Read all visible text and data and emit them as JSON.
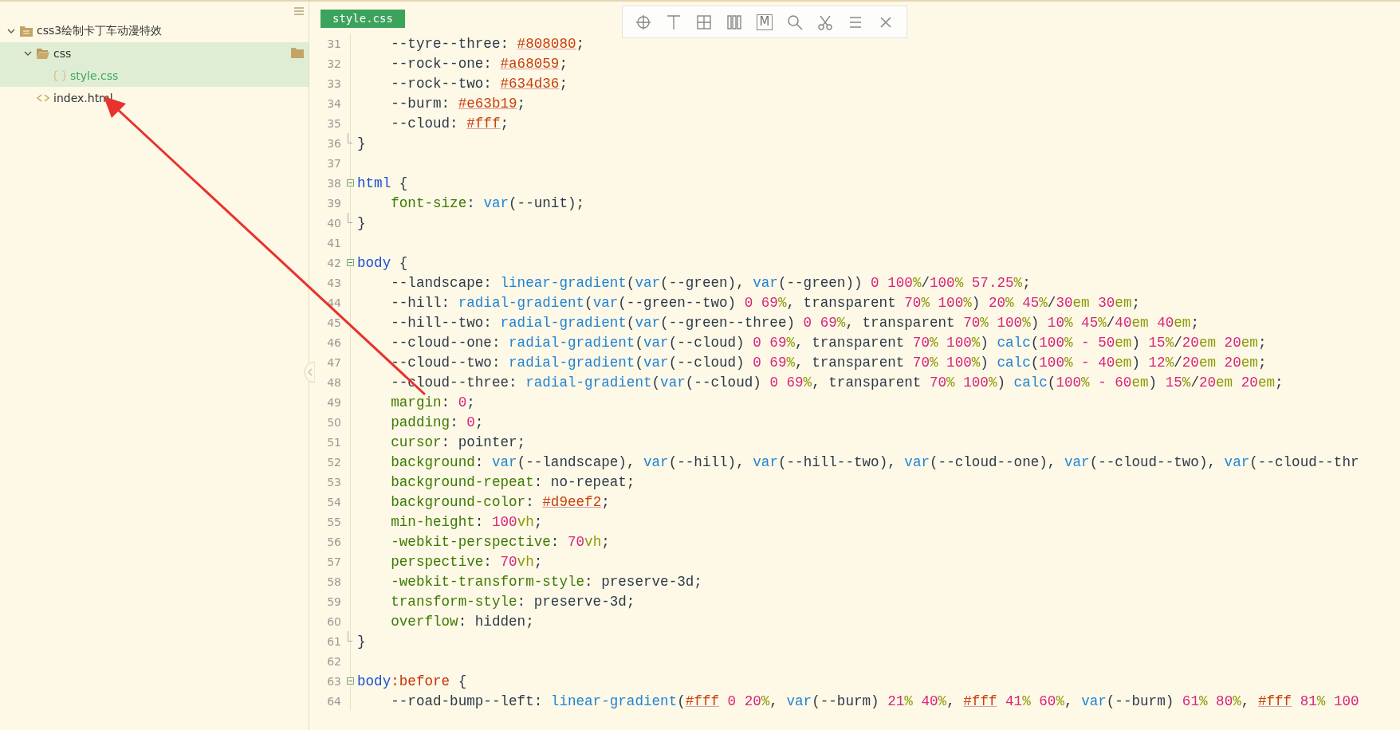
{
  "sidebar": {
    "tree": [
      {
        "label": "css3绘制卡丁车动漫特效",
        "kind": "project",
        "expanded": true,
        "selected": false,
        "hovered": false,
        "children": [
          {
            "label": "css",
            "kind": "folder",
            "expanded": true,
            "selected": true,
            "hovered": true,
            "children": [
              {
                "label": "style.css",
                "kind": "css",
                "selected": true,
                "open": true
              }
            ]
          },
          {
            "label": "index.html",
            "kind": "html",
            "selected": false,
            "hovered": false
          }
        ]
      }
    ]
  },
  "editor": {
    "tab": {
      "label": "style.css",
      "selected": true
    },
    "toolbar": [
      {
        "kind": "crosshair"
      },
      {
        "kind": "text-line"
      },
      {
        "kind": "grid"
      },
      {
        "kind": "columns"
      },
      {
        "kind": "letter-box",
        "label": "M"
      },
      {
        "kind": "search"
      },
      {
        "kind": "scissors"
      },
      {
        "kind": "menu"
      },
      {
        "kind": "close"
      }
    ],
    "lines": [
      {
        "number": "31",
        "indent": true,
        "code": [
          {
            "kind": "plain",
            "text": "--tyre--three: "
          },
          {
            "kind": "hex",
            "text": "#808080"
          },
          {
            "kind": "plain",
            "text": ";"
          }
        ]
      },
      {
        "number": "32",
        "indent": true,
        "code": [
          {
            "kind": "plain",
            "text": "--rock--one: "
          },
          {
            "kind": "hex",
            "text": "#a68059"
          },
          {
            "kind": "plain",
            "text": ";"
          }
        ]
      },
      {
        "number": "33",
        "indent": true,
        "code": [
          {
            "kind": "plain",
            "text": "--rock--two: "
          },
          {
            "kind": "hex",
            "text": "#634d36"
          },
          {
            "kind": "plain",
            "text": ";"
          }
        ]
      },
      {
        "number": "34",
        "indent": true,
        "code": [
          {
            "kind": "plain",
            "text": "--burm: "
          },
          {
            "kind": "hex",
            "text": "#e63b19"
          },
          {
            "kind": "plain",
            "text": ";"
          }
        ]
      },
      {
        "number": "35",
        "indent": true,
        "code": [
          {
            "kind": "plain",
            "text": "--cloud: "
          },
          {
            "kind": "hex",
            "text": "#fff"
          },
          {
            "kind": "plain",
            "text": ";"
          }
        ]
      },
      {
        "number": "36",
        "fold": {
          "kind": "end"
        },
        "code": [
          {
            "kind": "plain",
            "text": "}"
          }
        ]
      },
      {
        "number": "37"
      },
      {
        "number": "38",
        "fold": {
          "kind": "start"
        },
        "code": [
          {
            "kind": "sel",
            "text": "html"
          },
          {
            "kind": "plain",
            "text": " {"
          }
        ]
      },
      {
        "number": "39",
        "indent": true,
        "code": [
          {
            "kind": "prop",
            "text": "font-size"
          },
          {
            "kind": "plain",
            "text": ": "
          },
          {
            "kind": "fn",
            "text": "var"
          },
          {
            "kind": "plain",
            "text": "(--unit);"
          }
        ]
      },
      {
        "number": "40",
        "fold": {
          "kind": "end"
        },
        "code": [
          {
            "kind": "plain",
            "text": "}"
          }
        ]
      },
      {
        "number": "41"
      },
      {
        "number": "42",
        "fold": {
          "kind": "start"
        },
        "code": [
          {
            "kind": "sel",
            "text": "body"
          },
          {
            "kind": "plain",
            "text": " {"
          }
        ]
      },
      {
        "number": "43",
        "indent": true,
        "code": [
          {
            "kind": "plain",
            "text": "--landscape: "
          },
          {
            "kind": "fn",
            "text": "linear-gradient"
          },
          {
            "kind": "plain",
            "text": "("
          },
          {
            "kind": "fn",
            "text": "var"
          },
          {
            "kind": "plain",
            "text": "(--green), "
          },
          {
            "kind": "fn",
            "text": "var"
          },
          {
            "kind": "plain",
            "text": "(--green)) "
          },
          {
            "kind": "num",
            "text": "0 100"
          },
          {
            "kind": "unit",
            "text": "%"
          },
          {
            "kind": "plain",
            "text": "/"
          },
          {
            "kind": "num",
            "text": "100"
          },
          {
            "kind": "unit",
            "text": "%"
          },
          {
            "kind": "num",
            "text": " 57.25"
          },
          {
            "kind": "unit",
            "text": "%"
          },
          {
            "kind": "plain",
            "text": ";"
          }
        ]
      },
      {
        "number": "44",
        "indent": true,
        "code": [
          {
            "kind": "plain",
            "text": "--hill: "
          },
          {
            "kind": "fn",
            "text": "radial-gradient"
          },
          {
            "kind": "plain",
            "text": "("
          },
          {
            "kind": "fn",
            "text": "var"
          },
          {
            "kind": "plain",
            "text": "(--green--two) "
          },
          {
            "kind": "num",
            "text": "0 69"
          },
          {
            "kind": "unit",
            "text": "%"
          },
          {
            "kind": "plain",
            "text": ", transparent "
          },
          {
            "kind": "num",
            "text": "70"
          },
          {
            "kind": "unit",
            "text": "%"
          },
          {
            "kind": "num",
            "text": " 100"
          },
          {
            "kind": "unit",
            "text": "%"
          },
          {
            "kind": "plain",
            "text": ") "
          },
          {
            "kind": "num",
            "text": "20"
          },
          {
            "kind": "unit",
            "text": "%"
          },
          {
            "kind": "num",
            "text": " 45"
          },
          {
            "kind": "unit",
            "text": "%"
          },
          {
            "kind": "plain",
            "text": "/"
          },
          {
            "kind": "num",
            "text": "30"
          },
          {
            "kind": "unit",
            "text": "em"
          },
          {
            "kind": "num",
            "text": " 30"
          },
          {
            "kind": "unit",
            "text": "em"
          },
          {
            "kind": "plain",
            "text": ";"
          }
        ]
      },
      {
        "number": "45",
        "indent": true,
        "code": [
          {
            "kind": "plain",
            "text": "--hill--two: "
          },
          {
            "kind": "fn",
            "text": "radial-gradient"
          },
          {
            "kind": "plain",
            "text": "("
          },
          {
            "kind": "fn",
            "text": "var"
          },
          {
            "kind": "plain",
            "text": "(--green--three) "
          },
          {
            "kind": "num",
            "text": "0 69"
          },
          {
            "kind": "unit",
            "text": "%"
          },
          {
            "kind": "plain",
            "text": ", transparent "
          },
          {
            "kind": "num",
            "text": "70"
          },
          {
            "kind": "unit",
            "text": "%"
          },
          {
            "kind": "num",
            "text": " 100"
          },
          {
            "kind": "unit",
            "text": "%"
          },
          {
            "kind": "plain",
            "text": ") "
          },
          {
            "kind": "num",
            "text": "10"
          },
          {
            "kind": "unit",
            "text": "%"
          },
          {
            "kind": "num",
            "text": " 45"
          },
          {
            "kind": "unit",
            "text": "%"
          },
          {
            "kind": "plain",
            "text": "/"
          },
          {
            "kind": "num",
            "text": "40"
          },
          {
            "kind": "unit",
            "text": "em"
          },
          {
            "kind": "num",
            "text": " 40"
          },
          {
            "kind": "unit",
            "text": "em"
          },
          {
            "kind": "plain",
            "text": ";"
          }
        ]
      },
      {
        "number": "46",
        "indent": true,
        "code": [
          {
            "kind": "plain",
            "text": "--cloud--one: "
          },
          {
            "kind": "fn",
            "text": "radial-gradient"
          },
          {
            "kind": "plain",
            "text": "("
          },
          {
            "kind": "fn",
            "text": "var"
          },
          {
            "kind": "plain",
            "text": "(--cloud) "
          },
          {
            "kind": "num",
            "text": "0 69"
          },
          {
            "kind": "unit",
            "text": "%"
          },
          {
            "kind": "plain",
            "text": ", transparent "
          },
          {
            "kind": "num",
            "text": "70"
          },
          {
            "kind": "unit",
            "text": "%"
          },
          {
            "kind": "num",
            "text": " 100"
          },
          {
            "kind": "unit",
            "text": "%"
          },
          {
            "kind": "plain",
            "text": ") "
          },
          {
            "kind": "fn",
            "text": "calc"
          },
          {
            "kind": "plain",
            "text": "("
          },
          {
            "kind": "num",
            "text": "100"
          },
          {
            "kind": "unit",
            "text": "%"
          },
          {
            "kind": "num",
            "text": " - 50"
          },
          {
            "kind": "unit",
            "text": "em"
          },
          {
            "kind": "plain",
            "text": ") "
          },
          {
            "kind": "num",
            "text": "15"
          },
          {
            "kind": "unit",
            "text": "%"
          },
          {
            "kind": "plain",
            "text": "/"
          },
          {
            "kind": "num",
            "text": "20"
          },
          {
            "kind": "unit",
            "text": "em"
          },
          {
            "kind": "num",
            "text": " 20"
          },
          {
            "kind": "unit",
            "text": "em"
          },
          {
            "kind": "plain",
            "text": ";"
          }
        ]
      },
      {
        "number": "47",
        "indent": true,
        "code": [
          {
            "kind": "plain",
            "text": "--cloud--two: "
          },
          {
            "kind": "fn",
            "text": "radial-gradient"
          },
          {
            "kind": "plain",
            "text": "("
          },
          {
            "kind": "fn",
            "text": "var"
          },
          {
            "kind": "plain",
            "text": "(--cloud) "
          },
          {
            "kind": "num",
            "text": "0 69"
          },
          {
            "kind": "unit",
            "text": "%"
          },
          {
            "kind": "plain",
            "text": ", transparent "
          },
          {
            "kind": "num",
            "text": "70"
          },
          {
            "kind": "unit",
            "text": "%"
          },
          {
            "kind": "num",
            "text": " 100"
          },
          {
            "kind": "unit",
            "text": "%"
          },
          {
            "kind": "plain",
            "text": ") "
          },
          {
            "kind": "fn",
            "text": "calc"
          },
          {
            "kind": "plain",
            "text": "("
          },
          {
            "kind": "num",
            "text": "100"
          },
          {
            "kind": "unit",
            "text": "%"
          },
          {
            "kind": "num",
            "text": " - 40"
          },
          {
            "kind": "unit",
            "text": "em"
          },
          {
            "kind": "plain",
            "text": ") "
          },
          {
            "kind": "num",
            "text": "12"
          },
          {
            "kind": "unit",
            "text": "%"
          },
          {
            "kind": "plain",
            "text": "/"
          },
          {
            "kind": "num",
            "text": "20"
          },
          {
            "kind": "unit",
            "text": "em"
          },
          {
            "kind": "num",
            "text": " 20"
          },
          {
            "kind": "unit",
            "text": "em"
          },
          {
            "kind": "plain",
            "text": ";"
          }
        ]
      },
      {
        "number": "48",
        "indent": true,
        "code": [
          {
            "kind": "plain",
            "text": "--cloud--three: "
          },
          {
            "kind": "fn",
            "text": "radial-gradient"
          },
          {
            "kind": "plain",
            "text": "("
          },
          {
            "kind": "fn",
            "text": "var"
          },
          {
            "kind": "plain",
            "text": "(--cloud) "
          },
          {
            "kind": "num",
            "text": "0 69"
          },
          {
            "kind": "unit",
            "text": "%"
          },
          {
            "kind": "plain",
            "text": ", transparent "
          },
          {
            "kind": "num",
            "text": "70"
          },
          {
            "kind": "unit",
            "text": "%"
          },
          {
            "kind": "num",
            "text": " 100"
          },
          {
            "kind": "unit",
            "text": "%"
          },
          {
            "kind": "plain",
            "text": ") "
          },
          {
            "kind": "fn",
            "text": "calc"
          },
          {
            "kind": "plain",
            "text": "("
          },
          {
            "kind": "num",
            "text": "100"
          },
          {
            "kind": "unit",
            "text": "%"
          },
          {
            "kind": "num",
            "text": " - 60"
          },
          {
            "kind": "unit",
            "text": "em"
          },
          {
            "kind": "plain",
            "text": ") "
          },
          {
            "kind": "num",
            "text": "15"
          },
          {
            "kind": "unit",
            "text": "%"
          },
          {
            "kind": "plain",
            "text": "/"
          },
          {
            "kind": "num",
            "text": "20"
          },
          {
            "kind": "unit",
            "text": "em"
          },
          {
            "kind": "num",
            "text": " 20"
          },
          {
            "kind": "unit",
            "text": "em"
          },
          {
            "kind": "plain",
            "text": ";"
          }
        ]
      },
      {
        "number": "49",
        "indent": true,
        "code": [
          {
            "kind": "prop",
            "text": "margin"
          },
          {
            "kind": "plain",
            "text": ": "
          },
          {
            "kind": "num",
            "text": "0"
          },
          {
            "kind": "plain",
            "text": ";"
          }
        ]
      },
      {
        "number": "50",
        "indent": true,
        "code": [
          {
            "kind": "prop",
            "text": "padding"
          },
          {
            "kind": "plain",
            "text": ": "
          },
          {
            "kind": "num",
            "text": "0"
          },
          {
            "kind": "plain",
            "text": ";"
          }
        ]
      },
      {
        "number": "51",
        "indent": true,
        "code": [
          {
            "kind": "prop",
            "text": "cursor"
          },
          {
            "kind": "plain",
            "text": ": pointer;"
          }
        ]
      },
      {
        "number": "52",
        "indent": true,
        "code": [
          {
            "kind": "prop",
            "text": "background"
          },
          {
            "kind": "plain",
            "text": ": "
          },
          {
            "kind": "fn",
            "text": "var"
          },
          {
            "kind": "plain",
            "text": "(--landscape), "
          },
          {
            "kind": "fn",
            "text": "var"
          },
          {
            "kind": "plain",
            "text": "(--hill), "
          },
          {
            "kind": "fn",
            "text": "var"
          },
          {
            "kind": "plain",
            "text": "(--hill--two), "
          },
          {
            "kind": "fn",
            "text": "var"
          },
          {
            "kind": "plain",
            "text": "(--cloud--one), "
          },
          {
            "kind": "fn",
            "text": "var"
          },
          {
            "kind": "plain",
            "text": "(--cloud--two), "
          },
          {
            "kind": "fn",
            "text": "var"
          },
          {
            "kind": "plain",
            "text": "(--cloud--thr"
          }
        ]
      },
      {
        "number": "53",
        "indent": true,
        "code": [
          {
            "kind": "prop",
            "text": "background-repeat"
          },
          {
            "kind": "plain",
            "text": ": no-repeat;"
          }
        ]
      },
      {
        "number": "54",
        "indent": true,
        "code": [
          {
            "kind": "prop",
            "text": "background-color"
          },
          {
            "kind": "plain",
            "text": ": "
          },
          {
            "kind": "hex",
            "text": "#d9eef2"
          },
          {
            "kind": "plain",
            "text": ";"
          }
        ]
      },
      {
        "number": "55",
        "indent": true,
        "code": [
          {
            "kind": "prop",
            "text": "min-height"
          },
          {
            "kind": "plain",
            "text": ": "
          },
          {
            "kind": "num",
            "text": "100"
          },
          {
            "kind": "unit",
            "text": "vh"
          },
          {
            "kind": "plain",
            "text": ";"
          }
        ]
      },
      {
        "number": "56",
        "indent": true,
        "code": [
          {
            "kind": "prop",
            "text": "-webkit-perspective"
          },
          {
            "kind": "plain",
            "text": ": "
          },
          {
            "kind": "num",
            "text": "70"
          },
          {
            "kind": "unit",
            "text": "vh"
          },
          {
            "kind": "plain",
            "text": ";"
          }
        ]
      },
      {
        "number": "57",
        "indent": true,
        "code": [
          {
            "kind": "prop",
            "text": "perspective"
          },
          {
            "kind": "plain",
            "text": ": "
          },
          {
            "kind": "num",
            "text": "70"
          },
          {
            "kind": "unit",
            "text": "vh"
          },
          {
            "kind": "plain",
            "text": ";"
          }
        ]
      },
      {
        "number": "58",
        "indent": true,
        "code": [
          {
            "kind": "prop",
            "text": "-webkit-transform-style"
          },
          {
            "kind": "plain",
            "text": ": preserve-3d;"
          }
        ]
      },
      {
        "number": "59",
        "indent": true,
        "code": [
          {
            "kind": "prop",
            "text": "transform-style"
          },
          {
            "kind": "plain",
            "text": ": preserve-3d;"
          }
        ]
      },
      {
        "number": "60",
        "indent": true,
        "code": [
          {
            "kind": "prop",
            "text": "overflow"
          },
          {
            "kind": "plain",
            "text": ": hidden;"
          }
        ]
      },
      {
        "number": "61",
        "fold": {
          "kind": "end"
        },
        "code": [
          {
            "kind": "plain",
            "text": "}"
          }
        ]
      },
      {
        "number": "62"
      },
      {
        "number": "63",
        "fold": {
          "kind": "start"
        },
        "code": [
          {
            "kind": "sel",
            "text": "body"
          },
          {
            "kind": "pseudo",
            "text": ":before"
          },
          {
            "kind": "plain",
            "text": " {"
          }
        ]
      },
      {
        "number": "64",
        "indent": true,
        "code": [
          {
            "kind": "plain",
            "text": "--road-bump--left: "
          },
          {
            "kind": "fn",
            "text": "linear-gradient"
          },
          {
            "kind": "plain",
            "text": "("
          },
          {
            "kind": "hex",
            "text": "#fff"
          },
          {
            "kind": "num",
            "text": " 0 20"
          },
          {
            "kind": "unit",
            "text": "%"
          },
          {
            "kind": "plain",
            "text": ", "
          },
          {
            "kind": "fn",
            "text": "var"
          },
          {
            "kind": "plain",
            "text": "(--burm) "
          },
          {
            "kind": "num",
            "text": "21"
          },
          {
            "kind": "unit",
            "text": "%"
          },
          {
            "kind": "num",
            "text": " 40"
          },
          {
            "kind": "unit",
            "text": "%"
          },
          {
            "kind": "plain",
            "text": ", "
          },
          {
            "kind": "hex",
            "text": "#fff"
          },
          {
            "kind": "num",
            "text": " 41"
          },
          {
            "kind": "unit",
            "text": "%"
          },
          {
            "kind": "num",
            "text": " 60"
          },
          {
            "kind": "unit",
            "text": "%"
          },
          {
            "kind": "plain",
            "text": ", "
          },
          {
            "kind": "fn",
            "text": "var"
          },
          {
            "kind": "plain",
            "text": "(--burm) "
          },
          {
            "kind": "num",
            "text": "61"
          },
          {
            "kind": "unit",
            "text": "%"
          },
          {
            "kind": "num",
            "text": " 80"
          },
          {
            "kind": "unit",
            "text": "%"
          },
          {
            "kind": "plain",
            "text": ", "
          },
          {
            "kind": "hex",
            "text": "#fff"
          },
          {
            "kind": "num",
            "text": " 81"
          },
          {
            "kind": "unit",
            "text": "%"
          },
          {
            "kind": "num",
            "text": " 100"
          }
        ]
      }
    ]
  },
  "annotation": {
    "kind": "arrow"
  }
}
